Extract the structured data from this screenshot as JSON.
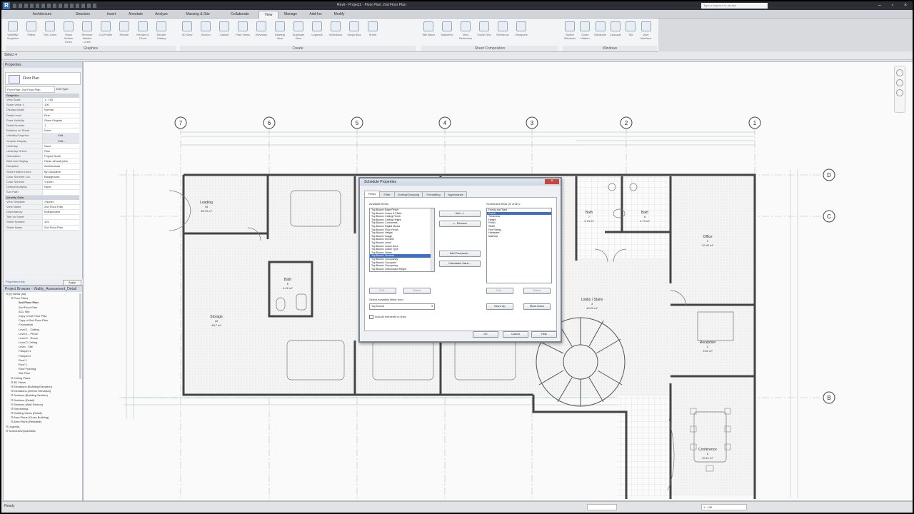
{
  "app": {
    "logo": "R",
    "window_title": "Revit - Project1 - Floor Plan: 2nd Floor Plan",
    "search_placeholder": "Type a keyword or phrase"
  },
  "tabs": [
    "Architecture",
    "Structure",
    "Insert",
    "Annotate",
    "Analyze",
    "Massing & Site",
    "Collaborate",
    "View",
    "Manage",
    "Add-Ins",
    "Modify"
  ],
  "active_tab": "View",
  "ribbon": {
    "graphics_buttons": [
      "Visibility/ Graphics",
      "Filters",
      "Thin Lines",
      "Show Hidden Lines",
      "Remove Hidden Lines",
      "Cut Profile",
      "Render",
      "Render in Cloud",
      "Render Gallery"
    ],
    "create_buttons": [
      "3D View",
      "Section",
      "Callout",
      "Plan Views",
      "Elevation",
      "Drafting View",
      "Duplicate View",
      "Legends",
      "Schedules",
      "Scope Box",
      "Sheet"
    ],
    "sheet_buttons": [
      "Title Block",
      "Matchline",
      "View Reference",
      "Guide Grid",
      "Revisions",
      "Viewports"
    ],
    "window_buttons": [
      "Switch Windows",
      "Close Hidden",
      "Replicate",
      "Cascade",
      "Tile",
      "User Interface"
    ],
    "panels": [
      "Graphics",
      "Create",
      "Sheet Composition",
      "Windows"
    ]
  },
  "options_bar": {
    "label": "Select ▾"
  },
  "properties": {
    "header": "Properties",
    "type_label": "Floor Plan",
    "instance": "Floor Plan: 2nd Floor Plan",
    "edit_type": "Edit Type",
    "categories": [
      {
        "name": "Graphics",
        "rows": [
          [
            "View Scale",
            "1 : 100"
          ],
          [
            "Scale Value 1:",
            "100"
          ],
          [
            "Display Model",
            "Normal"
          ],
          [
            "Detail Level",
            "Fine"
          ],
          [
            "Parts Visibility",
            "Show Original"
          ],
          [
            "Detail Number",
            "1"
          ],
          [
            "Rotation on Sheet",
            "None"
          ],
          [
            "Visibility/Graphics",
            "Edit..."
          ],
          [
            "Graphic Display",
            "Edit..."
          ],
          [
            "Underlay",
            "None"
          ],
          [
            "Underlay Orient.",
            "Plan"
          ],
          [
            "Orientation",
            "Project North"
          ],
          [
            "Wall Join Display",
            "Clean all wall joins"
          ],
          [
            "Discipline",
            "Architectural"
          ],
          [
            "Show Hidden Lines",
            "By Discipline"
          ],
          [
            "Color Scheme Loc.",
            "Background"
          ],
          [
            "Color Scheme",
            "<none>"
          ],
          [
            "Default Analysis",
            "None"
          ],
          [
            "Sun Path",
            ""
          ]
        ]
      },
      {
        "name": "Identity Data",
        "rows": [
          [
            "View Template",
            "<None>"
          ],
          [
            "View Name",
            "2nd Floor Plan"
          ],
          [
            "Dependency",
            "Independent"
          ],
          [
            "Title on Sheet",
            ""
          ],
          [
            "Sheet Number",
            "101"
          ],
          [
            "Sheet Name",
            "2nd Floor Plan"
          ]
        ]
      }
    ],
    "help_link": "Properties help",
    "apply": "Apply"
  },
  "project_browser": {
    "header": "Project Browser - Vitality_Assessment_Detail",
    "items": [
      {
        "t": "[0] Views (all)",
        "d": 0,
        "b": false
      },
      {
        "t": "Floor Plans",
        "d": 1,
        "b": false
      },
      {
        "t": "2nd Floor Plan",
        "d": 2,
        "b": true
      },
      {
        "t": "2nd Floor Plan",
        "d": 2,
        "b": false
      },
      {
        "t": "ACL Site",
        "d": 2,
        "b": false
      },
      {
        "t": "Copy of 1st Floor Plan",
        "d": 2,
        "b": false
      },
      {
        "t": "Copy of 2nd Floor Plan",
        "d": 2,
        "b": false
      },
      {
        "t": "Foundation",
        "d": 2,
        "b": false
      },
      {
        "t": "Level 1 - Ceiling",
        "d": 2,
        "b": false
      },
      {
        "t": "Level 1 - Photo",
        "d": 2,
        "b": false
      },
      {
        "t": "Level 2 - Room",
        "d": 2,
        "b": false
      },
      {
        "t": "Level 2 Ceiling",
        "d": 2,
        "b": false
      },
      {
        "t": "Level - Site",
        "d": 2,
        "b": false
      },
      {
        "t": "Parapet 1",
        "d": 2,
        "b": false
      },
      {
        "t": "Parapet 2",
        "d": 2,
        "b": false
      },
      {
        "t": "Roof 1",
        "d": 2,
        "b": false
      },
      {
        "t": "Roof 2",
        "d": 2,
        "b": false
      },
      {
        "t": "Roof Framing",
        "d": 2,
        "b": false
      },
      {
        "t": "Site Plan",
        "d": 2,
        "b": false
      },
      {
        "t": "Ceiling Plans",
        "d": 1,
        "b": false
      },
      {
        "t": "3D Views",
        "d": 1,
        "b": false
      },
      {
        "t": "Elevations (Building Elevation)",
        "d": 1,
        "b": false
      },
      {
        "t": "Elevations (Interior Elevation)",
        "d": 1,
        "b": false
      },
      {
        "t": "Sections (Building Section)",
        "d": 1,
        "b": false
      },
      {
        "t": "Sections (Detail)",
        "d": 1,
        "b": false
      },
      {
        "t": "Sections (Wall Section)",
        "d": 1,
        "b": false
      },
      {
        "t": "Renderings",
        "d": 1,
        "b": false
      },
      {
        "t": "Drafting Views (Detail)",
        "d": 1,
        "b": false
      },
      {
        "t": "Area Plans (Gross Building)",
        "d": 1,
        "b": false
      },
      {
        "t": "Area Plans (Rentable)",
        "d": 1,
        "b": false
      },
      {
        "t": "Legends",
        "d": 0,
        "b": false
      },
      {
        "t": "Schedules/Quantities",
        "d": 0,
        "b": false
      }
    ]
  },
  "plan": {
    "grid_top": [
      "7",
      "6",
      "5",
      "4",
      "3",
      "2",
      "1"
    ],
    "grid_right": [
      "D",
      "C",
      "B"
    ],
    "rooms": [
      {
        "name": "Loading",
        "num": "15",
        "area": "39.72 m²"
      },
      {
        "name": "Bath",
        "num": "6",
        "area": "4.22 m²"
      },
      {
        "name": "Storage",
        "num": "10",
        "area": "48.7 m²"
      },
      {
        "name": "Bath",
        "num": "7",
        "area": "2.73 m²"
      },
      {
        "name": "Bath",
        "num": "8",
        "area": "2.73 m²"
      },
      {
        "name": "Office",
        "num": "2",
        "area": "22.42 m²"
      },
      {
        "name": "Lobby / Stairs",
        "num": "3",
        "area": "19.22 m²"
      },
      {
        "name": "Reception",
        "num": "4",
        "area": "9.51 m²"
      },
      {
        "name": "Conference",
        "num": "5",
        "area": "20.11 m²"
      }
    ]
  },
  "dialog": {
    "title": "Schedule Properties",
    "tabs": [
      "Fields",
      "Filter",
      "Sorting/Grouping",
      "Formatting",
      "Appearance"
    ],
    "available_label": "Available fields:",
    "available": [
      "Top Bound: Base Finish",
      "Top Bound: Lease & Pfield",
      "Top Bound: Ceiling Finish",
      "Top Bound: Ceiling Height",
      "Top Bound: Comments",
      "Top Bound: Digital Media",
      "Top Bound: Floor Finish",
      "Top Bound: Height",
      "Top Bound: Image",
      "Top Bound: IfcGUID",
      "Top Bound: Level",
      "Top Bound: Lease Area",
      "Top Bound: Lease Type",
      "Top Bound: Name",
      "Top Bound: Number",
      "Top Bound: Occupancy",
      "Top Bound: Occupant",
      "Top Bound: Occupancy",
      "Top Bound: Unbounded Height"
    ],
    "available_selected": 14,
    "add_btn": "Add -->",
    "remove_btn": "<-- Remove",
    "add_param_btn": "Add Parameter...",
    "calc_btn": "Calculated Value...",
    "scheduled_label": "Scheduled fields (in order):",
    "scheduled": [
      "Family and Type",
      "Count",
      "Thickness",
      "Height",
      "Finish",
      "Width",
      "Fire Rating",
      "Hardware",
      "Material"
    ],
    "scheduled_selected": 1,
    "edit_btn": "Edit...",
    "delete_btn": "Delete",
    "edit_btn2": "Edit...",
    "delete_btn2": "Delete",
    "select_from_label": "Select available fields from:",
    "select_from_value": "Top Bound",
    "include_links": "Include elements in links",
    "move_up": "Move Up",
    "move_down": "Move Down",
    "ok": "OK",
    "cancel": "Cancel",
    "help": "Help"
  },
  "status": {
    "text": "Ready",
    "scale": "1 : 100"
  }
}
